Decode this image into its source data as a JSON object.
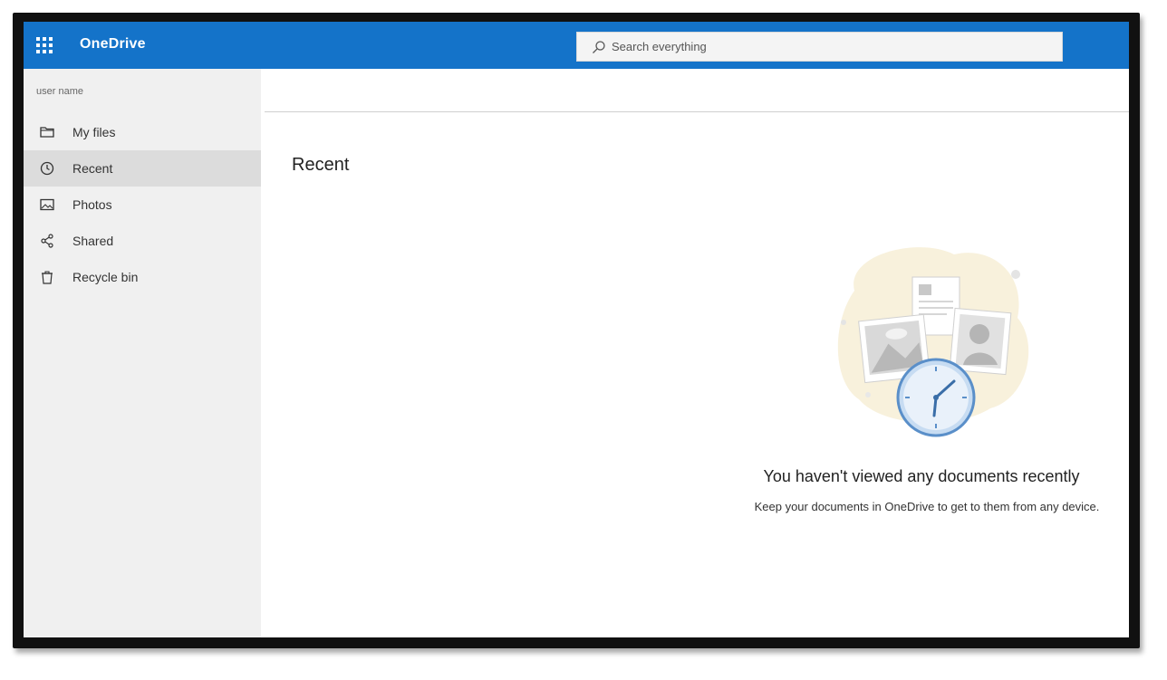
{
  "app": {
    "title": "OneDrive"
  },
  "search": {
    "placeholder": "Search everything"
  },
  "sidebar": {
    "user_name": "user name",
    "items": [
      {
        "label": "My files",
        "icon": "folder-icon"
      },
      {
        "label": "Recent",
        "icon": "clock-icon",
        "active": true
      },
      {
        "label": "Photos",
        "icon": "image-icon"
      },
      {
        "label": "Shared",
        "icon": "share-icon"
      },
      {
        "label": "Recycle bin",
        "icon": "recycle-bin-icon"
      }
    ]
  },
  "main": {
    "title": "Recent",
    "empty_state": {
      "heading": "You haven't viewed any documents recently",
      "subtext": "Keep your documents in OneDrive to get to them from any device."
    }
  },
  "colors": {
    "accent": "#1473c9",
    "sidebar_bg": "#f0f0f0",
    "active_item": "#dcdcdc"
  }
}
